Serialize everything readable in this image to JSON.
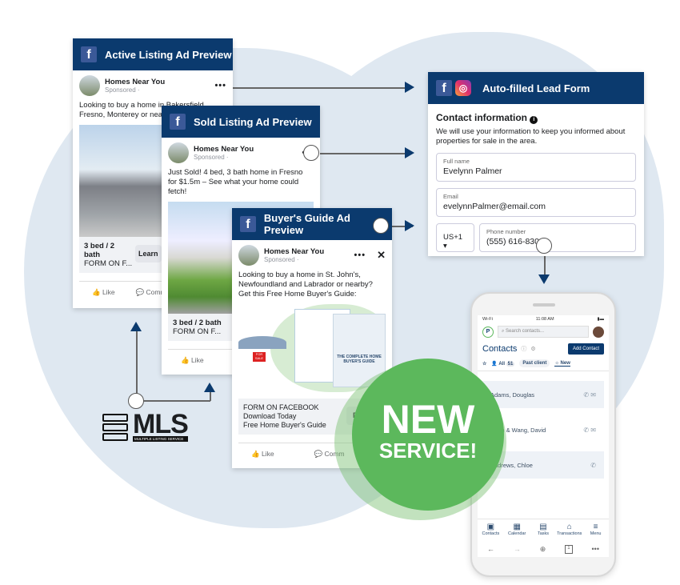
{
  "active_ad": {
    "title": "Active Listing Ad Preview",
    "page": "Homes Near You",
    "sponsored": "Sponsored ·",
    "text": "Looking to buy a home in Bakersfield, Fresno, Monterey or nearby?",
    "cta_title": "3 bed / 2 bath",
    "cta_sub": "FORM ON F...",
    "cta_button": "Learn",
    "like": "Like",
    "comment": "Comm"
  },
  "sold_ad": {
    "title": "Sold Listing Ad Preview",
    "page": "Homes Near You",
    "sponsored": "Sponsored ·",
    "text": "Just Sold! 4 bed, 3 bath home in Fresno for $1.5m – See what your home could fetch!",
    "cta_title": "3 bed / 2 bath",
    "cta_sub": "FORM ON F...",
    "like": "Like"
  },
  "guide_ad": {
    "title": "Buyer's Guide Ad Preview",
    "page": "Homes Near You",
    "sponsored": "Sponsored ·",
    "text": "Looking to buy a home in St. John's, Newfoundland and Labrador or nearby? Get this Free Home Buyer's Guide:",
    "guide_cover": "THE COMPLETE HOME BUYER'S GUIDE",
    "sale_sign": "FOR SALE",
    "cta_lines": [
      "FORM ON FACEBOOK",
      "Download Today",
      "Free Home Buyer's Guide"
    ],
    "cta_button": "Downl",
    "like": "Like",
    "comment": "Comm"
  },
  "lead_form": {
    "title": "Auto-filled Lead Form",
    "heading": "Contact information",
    "info_icon": "info-icon",
    "description": "We will use your information to keep you informed about properties for sale in the area.",
    "fields": [
      {
        "label": "Full name",
        "value": "Evelynn Palmer"
      },
      {
        "label": "Email",
        "value": "evelynnPalmer@email.com"
      }
    ],
    "country_code": "US+1",
    "phone_label": "Phone number",
    "phone_value": "(555) 616-8300"
  },
  "badge": {
    "line1": "NEW",
    "line2": "SERVICE!"
  },
  "mls": {
    "name": "MLS",
    "subtitle": "MULTIPLE LISTING SERVICE"
  },
  "phone": {
    "carrier": "Wi-Fi",
    "time": "11:08 AM",
    "search_placeholder": "Search contacts...",
    "title": "Contacts",
    "add_button": "Add Contact",
    "filters": [
      "All",
      "51",
      "Past client",
      "New"
    ],
    "contacts": [
      "Adams, Douglas",
      "Nash & Wang, David",
      "Andrews, Chloe"
    ],
    "nav": [
      "Contacts",
      "Calendar",
      "Tasks",
      "Transactions",
      "Menu"
    ],
    "tab_count": "1"
  },
  "colors": {
    "navy": "#0b3a6e",
    "green": "#5cb85c",
    "blob": "#dfe8f1"
  }
}
